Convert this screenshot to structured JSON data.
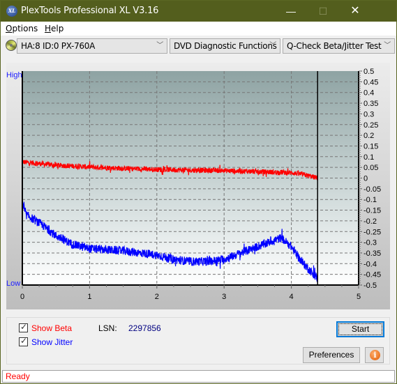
{
  "window": {
    "title": "PlexTools Professional XL V3.16",
    "icon_label": "XL",
    "minimize_label": "—",
    "maximize_label": "☐",
    "close_label": "✕"
  },
  "menu": {
    "items": [
      {
        "label": "Options",
        "accel": "O",
        "rest": "ptions"
      },
      {
        "label": "Help",
        "accel": "H",
        "rest": "elp"
      }
    ]
  },
  "toolbar": {
    "drive": "HA:8 ID:0  PX-760A",
    "function": "DVD Diagnostic Functions",
    "test": "Q-Check Beta/Jitter Test",
    "chevron": "﹀"
  },
  "chart_labels": {
    "high": "High",
    "low": "Low"
  },
  "chart_data": {
    "type": "line",
    "title": "",
    "xlabel": "",
    "ylabel": "",
    "xlim": [
      0,
      5
    ],
    "ylim": [
      -0.5,
      0.5
    ],
    "x_ticks": [
      "0",
      "1",
      "2",
      "3",
      "4",
      "5"
    ],
    "y_ticks": [
      "0.5",
      "0.45",
      "0.4",
      "0.35",
      "0.3",
      "0.25",
      "0.2",
      "0.15",
      "0.1",
      "0.05",
      "0",
      "-0.05",
      "-0.1",
      "-0.15",
      "-0.2",
      "-0.25",
      "-0.3",
      "-0.35",
      "-0.4",
      "-0.45",
      "-0.5"
    ],
    "grid": true,
    "end_marker_x": 4.39,
    "series": [
      {
        "name": "Beta",
        "color": "#ff0000",
        "noise": 0.012,
        "x": [
          0,
          0.25,
          0.5,
          1.0,
          1.5,
          2.0,
          2.5,
          3.0,
          3.5,
          4.0,
          4.2,
          4.39
        ],
        "y": [
          0.075,
          0.068,
          0.06,
          0.052,
          0.045,
          0.04,
          0.037,
          0.035,
          0.03,
          0.025,
          0.015,
          0.0
        ]
      },
      {
        "name": "Jitter",
        "color": "#0000ff",
        "noise": 0.02,
        "x": [
          0,
          0.05,
          0.1,
          0.3,
          0.5,
          0.75,
          1.0,
          1.5,
          2.0,
          2.25,
          2.5,
          2.75,
          3.0,
          3.25,
          3.5,
          3.75,
          3.85,
          4.0,
          4.15,
          4.3,
          4.39
        ],
        "y": [
          -0.12,
          -0.17,
          -0.18,
          -0.22,
          -0.27,
          -0.31,
          -0.33,
          -0.34,
          -0.36,
          -0.38,
          -0.39,
          -0.39,
          -0.38,
          -0.35,
          -0.32,
          -0.29,
          -0.28,
          -0.32,
          -0.39,
          -0.44,
          -0.47
        ]
      }
    ]
  },
  "controls": {
    "show_beta": "Show Beta",
    "show_beta_checked": true,
    "show_jitter": "Show Jitter",
    "show_jitter_checked": true,
    "lsn_label": "LSN:",
    "lsn_value": "2297856",
    "start_label": "Start",
    "preferences_label": "Preferences",
    "info_label": "i"
  },
  "status": {
    "text": "Ready"
  }
}
